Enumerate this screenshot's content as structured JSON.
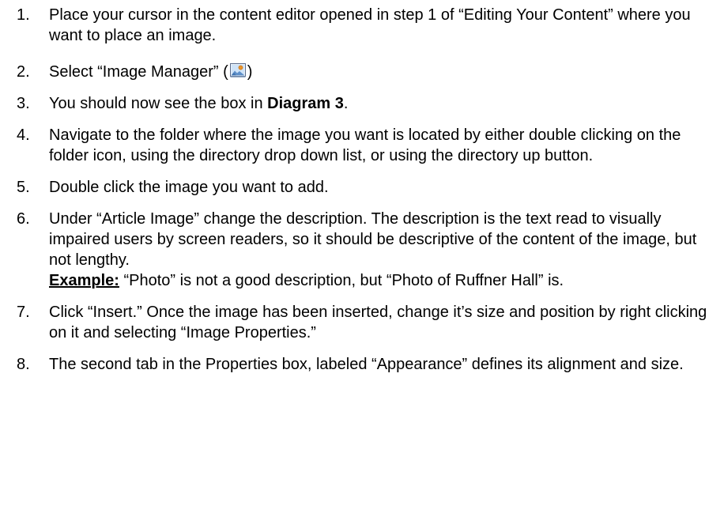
{
  "steps": [
    {
      "number": "1.",
      "text": "Place your cursor in the content editor opened in step 1 of “Editing Your Content” where you want to place an image."
    },
    {
      "number": "2.",
      "text_before": "Select “Image Manager” (",
      "icon": "image-manager-icon",
      "text_after": ")"
    },
    {
      "number": "3.",
      "text_before": "You should now see the box in ",
      "bold": "Diagram 3",
      "text_after": "."
    },
    {
      "number": "4.",
      "text": "Navigate to the folder where the image you want is located by either double clicking on the folder icon, using the directory drop down list, or using the directory up button."
    },
    {
      "number": "5.",
      "text": "Double click the image you want to add."
    },
    {
      "number": "6.",
      "text": "Under “Article Image” change the description. The description is the text read to visually impaired users by screen readers, so it should be descriptive of the content of the image, but not lengthy.",
      "example_label": "Example:",
      "example_text": " “Photo” is not a good description, but “Photo of Ruffner Hall” is."
    },
    {
      "number": "7.",
      "text": "Click “Insert.” Once the image has been inserted, change it’s size and position by right clicking on it and selecting “Image Properties.”"
    },
    {
      "number": "8.",
      "text": "The second tab in the Properties box, labeled “Appearance” defines its alignment and size."
    }
  ]
}
